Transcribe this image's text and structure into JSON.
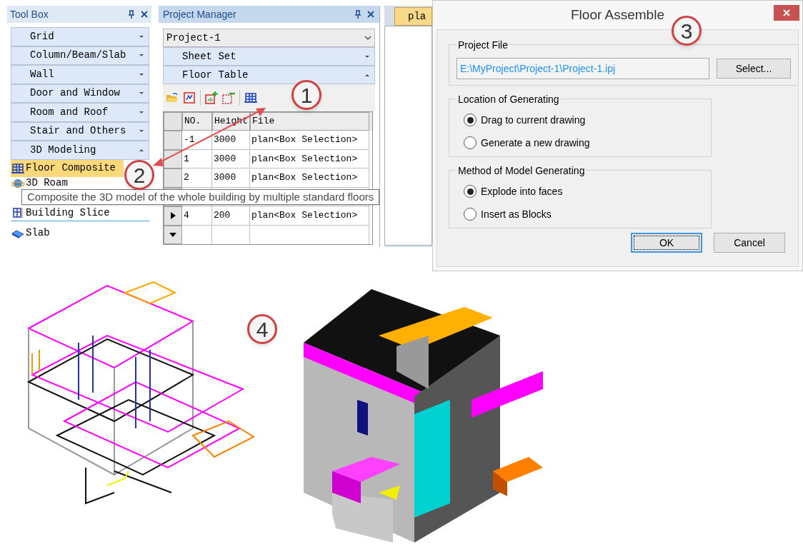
{
  "toolbox": {
    "title": "Tool Box",
    "sections": [
      {
        "label": "Grid",
        "expanded": false
      },
      {
        "label": "Column/Beam/Slab",
        "expanded": false
      },
      {
        "label": "Wall",
        "expanded": false
      },
      {
        "label": "Door and Window",
        "expanded": false
      },
      {
        "label": "Room and Roof",
        "expanded": false
      },
      {
        "label": "Stair and Others",
        "expanded": false
      },
      {
        "label": "3D Modeling",
        "expanded": true
      }
    ],
    "items": [
      {
        "kind": "floor",
        "label": "Floor Composite",
        "selected": true
      },
      {
        "kind": "roam",
        "label": "3D Roam",
        "selected": false
      },
      {
        "kind": "slice",
        "label": "Building Slice",
        "selected": false
      },
      {
        "kind": "slab",
        "label": "Slab",
        "selected": false
      }
    ]
  },
  "project_manager": {
    "title": "Project Manager",
    "project": "Project-1",
    "sections": [
      {
        "label": "Sheet Set",
        "expanded": false
      },
      {
        "label": "Floor Table",
        "expanded": true
      }
    ],
    "toolbar": [
      {
        "kind": "open"
      },
      {
        "kind": "link"
      },
      {
        "kind": "add"
      },
      {
        "kind": "remove"
      },
      {
        "kind": "floor"
      }
    ],
    "table": {
      "columns": [
        "NO.",
        "Height",
        "File"
      ],
      "rows": [
        {
          "cells": [
            "-1",
            "3000",
            "plan<Box Selection>"
          ],
          "current": false
        },
        {
          "cells": [
            "1",
            "3000",
            "plan<Box Selection>"
          ],
          "current": false
        },
        {
          "cells": [
            "2",
            "3000",
            "plan<Box Selection>"
          ],
          "current": false
        },
        {
          "cells": [
            "4",
            "200",
            "plan<Box Selection>"
          ],
          "current": true
        }
      ]
    }
  },
  "tooltip": "Composite the 3D model of the whole building by multiple standard floors",
  "document_tab": "pla",
  "dialog": {
    "title": "Floor Assemble",
    "project_file": {
      "label": "Project File",
      "value": "E:\\MyProject\\Project-1\\Project-1.ipj",
      "button": "Select..."
    },
    "location": {
      "label": "Location of Generating",
      "options": [
        {
          "label": "Drag to current drawing",
          "selected": true
        },
        {
          "label": "Generate a new drawing",
          "selected": false
        }
      ]
    },
    "method": {
      "label": "Method of Model Generating",
      "options": [
        {
          "label": "Explode into faces",
          "selected": true
        },
        {
          "label": "Insert as Blocks",
          "selected": false
        }
      ]
    },
    "buttons": [
      {
        "label": "OK",
        "focused": true
      },
      {
        "label": "Cancel",
        "focused": false
      }
    ]
  },
  "callouts": [
    "1",
    "2",
    "3",
    "4"
  ]
}
